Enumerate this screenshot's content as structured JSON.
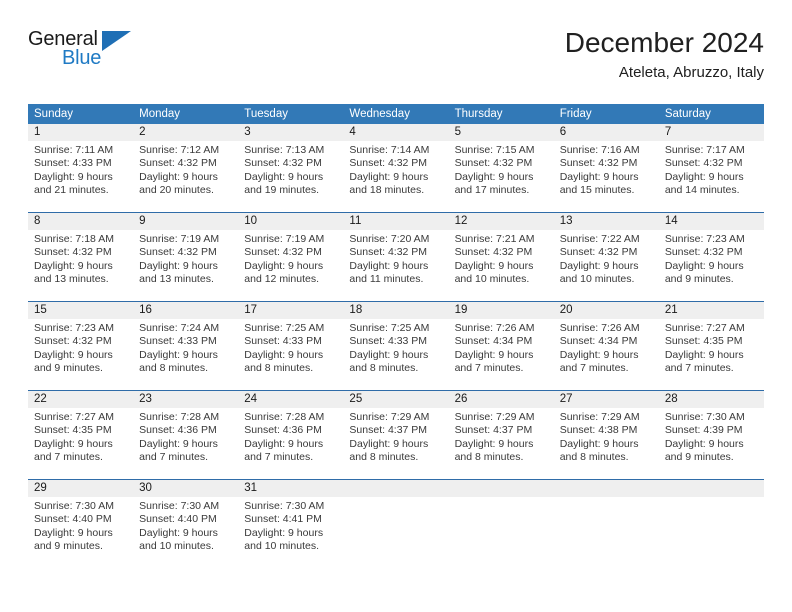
{
  "brand": {
    "name_top": "General",
    "name_bottom": "Blue",
    "accent_color": "#1f7ac4",
    "flag_color": "#1f6fb5"
  },
  "header": {
    "title": "December 2024",
    "subtitle": "Ateleta, Abruzzo, Italy",
    "header_bg": "#3279b7",
    "daynum_bg": "#efefef"
  },
  "weekdays": [
    "Sunday",
    "Monday",
    "Tuesday",
    "Wednesday",
    "Thursday",
    "Friday",
    "Saturday"
  ],
  "weeks": [
    [
      {
        "day": "1",
        "sunrise": "Sunrise: 7:11 AM",
        "sunset": "Sunset: 4:33 PM",
        "daylight1": "Daylight: 9 hours",
        "daylight2": "and 21 minutes."
      },
      {
        "day": "2",
        "sunrise": "Sunrise: 7:12 AM",
        "sunset": "Sunset: 4:32 PM",
        "daylight1": "Daylight: 9 hours",
        "daylight2": "and 20 minutes."
      },
      {
        "day": "3",
        "sunrise": "Sunrise: 7:13 AM",
        "sunset": "Sunset: 4:32 PM",
        "daylight1": "Daylight: 9 hours",
        "daylight2": "and 19 minutes."
      },
      {
        "day": "4",
        "sunrise": "Sunrise: 7:14 AM",
        "sunset": "Sunset: 4:32 PM",
        "daylight1": "Daylight: 9 hours",
        "daylight2": "and 18 minutes."
      },
      {
        "day": "5",
        "sunrise": "Sunrise: 7:15 AM",
        "sunset": "Sunset: 4:32 PM",
        "daylight1": "Daylight: 9 hours",
        "daylight2": "and 17 minutes."
      },
      {
        "day": "6",
        "sunrise": "Sunrise: 7:16 AM",
        "sunset": "Sunset: 4:32 PM",
        "daylight1": "Daylight: 9 hours",
        "daylight2": "and 15 minutes."
      },
      {
        "day": "7",
        "sunrise": "Sunrise: 7:17 AM",
        "sunset": "Sunset: 4:32 PM",
        "daylight1": "Daylight: 9 hours",
        "daylight2": "and 14 minutes."
      }
    ],
    [
      {
        "day": "8",
        "sunrise": "Sunrise: 7:18 AM",
        "sunset": "Sunset: 4:32 PM",
        "daylight1": "Daylight: 9 hours",
        "daylight2": "and 13 minutes."
      },
      {
        "day": "9",
        "sunrise": "Sunrise: 7:19 AM",
        "sunset": "Sunset: 4:32 PM",
        "daylight1": "Daylight: 9 hours",
        "daylight2": "and 13 minutes."
      },
      {
        "day": "10",
        "sunrise": "Sunrise: 7:19 AM",
        "sunset": "Sunset: 4:32 PM",
        "daylight1": "Daylight: 9 hours",
        "daylight2": "and 12 minutes."
      },
      {
        "day": "11",
        "sunrise": "Sunrise: 7:20 AM",
        "sunset": "Sunset: 4:32 PM",
        "daylight1": "Daylight: 9 hours",
        "daylight2": "and 11 minutes."
      },
      {
        "day": "12",
        "sunrise": "Sunrise: 7:21 AM",
        "sunset": "Sunset: 4:32 PM",
        "daylight1": "Daylight: 9 hours",
        "daylight2": "and 10 minutes."
      },
      {
        "day": "13",
        "sunrise": "Sunrise: 7:22 AM",
        "sunset": "Sunset: 4:32 PM",
        "daylight1": "Daylight: 9 hours",
        "daylight2": "and 10 minutes."
      },
      {
        "day": "14",
        "sunrise": "Sunrise: 7:23 AM",
        "sunset": "Sunset: 4:32 PM",
        "daylight1": "Daylight: 9 hours",
        "daylight2": "and 9 minutes."
      }
    ],
    [
      {
        "day": "15",
        "sunrise": "Sunrise: 7:23 AM",
        "sunset": "Sunset: 4:32 PM",
        "daylight1": "Daylight: 9 hours",
        "daylight2": "and 9 minutes."
      },
      {
        "day": "16",
        "sunrise": "Sunrise: 7:24 AM",
        "sunset": "Sunset: 4:33 PM",
        "daylight1": "Daylight: 9 hours",
        "daylight2": "and 8 minutes."
      },
      {
        "day": "17",
        "sunrise": "Sunrise: 7:25 AM",
        "sunset": "Sunset: 4:33 PM",
        "daylight1": "Daylight: 9 hours",
        "daylight2": "and 8 minutes."
      },
      {
        "day": "18",
        "sunrise": "Sunrise: 7:25 AM",
        "sunset": "Sunset: 4:33 PM",
        "daylight1": "Daylight: 9 hours",
        "daylight2": "and 8 minutes."
      },
      {
        "day": "19",
        "sunrise": "Sunrise: 7:26 AM",
        "sunset": "Sunset: 4:34 PM",
        "daylight1": "Daylight: 9 hours",
        "daylight2": "and 7 minutes."
      },
      {
        "day": "20",
        "sunrise": "Sunrise: 7:26 AM",
        "sunset": "Sunset: 4:34 PM",
        "daylight1": "Daylight: 9 hours",
        "daylight2": "and 7 minutes."
      },
      {
        "day": "21",
        "sunrise": "Sunrise: 7:27 AM",
        "sunset": "Sunset: 4:35 PM",
        "daylight1": "Daylight: 9 hours",
        "daylight2": "and 7 minutes."
      }
    ],
    [
      {
        "day": "22",
        "sunrise": "Sunrise: 7:27 AM",
        "sunset": "Sunset: 4:35 PM",
        "daylight1": "Daylight: 9 hours",
        "daylight2": "and 7 minutes."
      },
      {
        "day": "23",
        "sunrise": "Sunrise: 7:28 AM",
        "sunset": "Sunset: 4:36 PM",
        "daylight1": "Daylight: 9 hours",
        "daylight2": "and 7 minutes."
      },
      {
        "day": "24",
        "sunrise": "Sunrise: 7:28 AM",
        "sunset": "Sunset: 4:36 PM",
        "daylight1": "Daylight: 9 hours",
        "daylight2": "and 7 minutes."
      },
      {
        "day": "25",
        "sunrise": "Sunrise: 7:29 AM",
        "sunset": "Sunset: 4:37 PM",
        "daylight1": "Daylight: 9 hours",
        "daylight2": "and 8 minutes."
      },
      {
        "day": "26",
        "sunrise": "Sunrise: 7:29 AM",
        "sunset": "Sunset: 4:37 PM",
        "daylight1": "Daylight: 9 hours",
        "daylight2": "and 8 minutes."
      },
      {
        "day": "27",
        "sunrise": "Sunrise: 7:29 AM",
        "sunset": "Sunset: 4:38 PM",
        "daylight1": "Daylight: 9 hours",
        "daylight2": "and 8 minutes."
      },
      {
        "day": "28",
        "sunrise": "Sunrise: 7:30 AM",
        "sunset": "Sunset: 4:39 PM",
        "daylight1": "Daylight: 9 hours",
        "daylight2": "and 9 minutes."
      }
    ],
    [
      {
        "day": "29",
        "sunrise": "Sunrise: 7:30 AM",
        "sunset": "Sunset: 4:40 PM",
        "daylight1": "Daylight: 9 hours",
        "daylight2": "and 9 minutes."
      },
      {
        "day": "30",
        "sunrise": "Sunrise: 7:30 AM",
        "sunset": "Sunset: 4:40 PM",
        "daylight1": "Daylight: 9 hours",
        "daylight2": "and 10 minutes."
      },
      {
        "day": "31",
        "sunrise": "Sunrise: 7:30 AM",
        "sunset": "Sunset: 4:41 PM",
        "daylight1": "Daylight: 9 hours",
        "daylight2": "and 10 minutes."
      },
      {
        "day": "",
        "sunrise": "",
        "sunset": "",
        "daylight1": "",
        "daylight2": ""
      },
      {
        "day": "",
        "sunrise": "",
        "sunset": "",
        "daylight1": "",
        "daylight2": ""
      },
      {
        "day": "",
        "sunrise": "",
        "sunset": "",
        "daylight1": "",
        "daylight2": ""
      },
      {
        "day": "",
        "sunrise": "",
        "sunset": "",
        "daylight1": "",
        "daylight2": ""
      }
    ]
  ]
}
